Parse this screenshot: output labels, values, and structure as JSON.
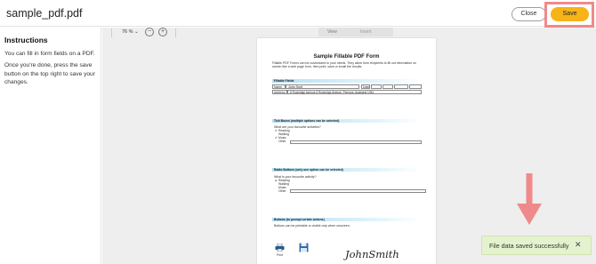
{
  "app": {
    "filename": "sample_pdf.pdf"
  },
  "header": {
    "close_label": "Close",
    "save_label": "Save"
  },
  "sidebar": {
    "title": "Instructions",
    "paragraphs": [
      "You can fill in form fields on a PDF.",
      "Once you're done, press the save button on the top right to save your changes."
    ]
  },
  "toolbar": {
    "zoom": "76 %",
    "zoom_out_glyph": "−",
    "zoom_in_glyph": "+",
    "modes": [
      "View",
      "Insert"
    ]
  },
  "pdf": {
    "title": "Sample Fillable PDF Form",
    "intro": "Fillable PDF Forms can be customized to your needs. They allow form recipients to fill out information on screen like a web page form, then print, save or email the results.",
    "fillable": {
      "heading": "Fillable Fields",
      "name_label": "Name",
      "name_value": "John Smit",
      "date_label": "Date",
      "address_label": "Address",
      "address_value": "6 Rockridge Avenue 6 Rockridge Avenue, Penrose, Auckland 1061"
    },
    "tick": {
      "heading": "Tick Boxes (multiple options can be selected)",
      "question": "What are your favourite activities?",
      "options": [
        {
          "mark": "✔",
          "label": "Reading"
        },
        {
          "mark": "",
          "label": "Walking"
        },
        {
          "mark": "✔",
          "label": "Music"
        },
        {
          "mark": "",
          "label": "Other"
        }
      ]
    },
    "radio": {
      "heading": "Radio Buttons (only one option can be selected)",
      "question": "What is your favourite activity?",
      "options": [
        {
          "mark": "●",
          "label": "Reading"
        },
        {
          "mark": "",
          "label": "Walking"
        },
        {
          "mark": "",
          "label": "Music"
        },
        {
          "mark": "",
          "label": "Other"
        }
      ]
    },
    "buttons": {
      "heading": "Buttons (to prompt certain actions)",
      "note": "Buttons can be printable or visible only when onscreen.",
      "print_label": "Print"
    },
    "signature": "JohnSmith"
  },
  "toast": {
    "message": "File data saved successfully",
    "close_glyph": "✕"
  },
  "colors": {
    "accent": "#f7b318",
    "highlight": "#f08a8a",
    "toast_bg": "#e5f2cf",
    "section_bar": "#b3def2"
  }
}
